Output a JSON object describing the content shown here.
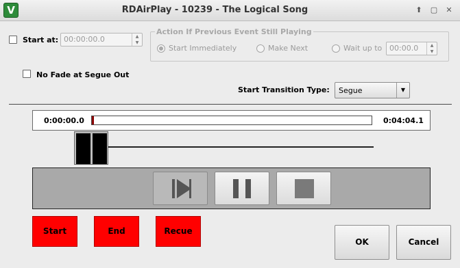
{
  "window": {
    "title": "RDAirPlay - 10239 - The Logical Song",
    "app_icon_glyph": "V",
    "controls": {
      "up_glyph": "⬆",
      "restore_glyph": "▢",
      "close_glyph": "✕"
    }
  },
  "start_at": {
    "label": "Start at:",
    "checked": false,
    "time_value": "00:00:00.0"
  },
  "previous_event": {
    "group_title": "Action If Previous Event Still Playing",
    "options": [
      {
        "label": "Start Immediately",
        "selected": true
      },
      {
        "label": "Make Next",
        "selected": false
      },
      {
        "label": "Wait up to",
        "selected": false
      }
    ],
    "wait_value": "00:00.0"
  },
  "no_fade": {
    "label": "No Fade at Segue Out",
    "checked": false
  },
  "transition": {
    "label": "Start Transition Type:",
    "value": "Segue"
  },
  "position": {
    "start_time": "0:00:00.0",
    "end_time": "0:04:04.1"
  },
  "transport": {
    "play_icon": "play-to-marker-icon",
    "pause_icon": "pause-icon",
    "stop_icon": "stop-icon"
  },
  "markers": {
    "start_label": "Start",
    "end_label": "End",
    "recue_label": "Recue"
  },
  "dialog": {
    "ok_label": "OK",
    "cancel_label": "Cancel"
  },
  "colors": {
    "marker_buttons": "#ff0000",
    "position_marker": "#8b0000",
    "transport_panel": "#a9a9a9"
  }
}
